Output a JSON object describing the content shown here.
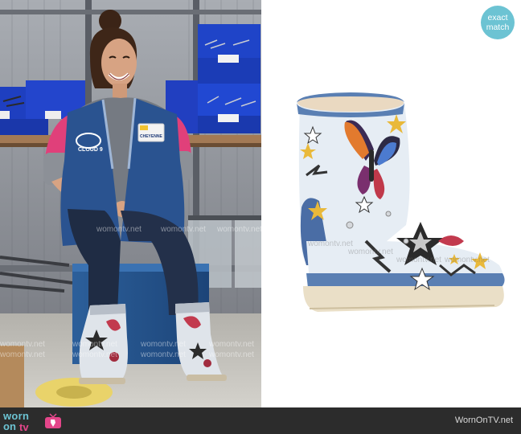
{
  "badge": {
    "line1": "exact",
    "line2": "match",
    "color": "#6cc3d3"
  },
  "watermark": {
    "text": "womontv.net"
  },
  "footer": {
    "logo_worn": "worn",
    "logo_on": "on",
    "logo_tv": "tv",
    "site_url": "WornOnTV.net"
  },
  "scene": {
    "vest_logo": "CLOUD 9",
    "name_tag": "CHEYENNE",
    "bin_labels": [
      "75 LOWE",
      "15 LOWE",
      "SONIC"
    ]
  },
  "colors": {
    "brand_teal": "#6cc3d3",
    "brand_pink": "#e4468a",
    "footer_bg": "#2c2c2c",
    "vest_blue": "#2a5390",
    "boot_denim": "#5a7fb3"
  }
}
